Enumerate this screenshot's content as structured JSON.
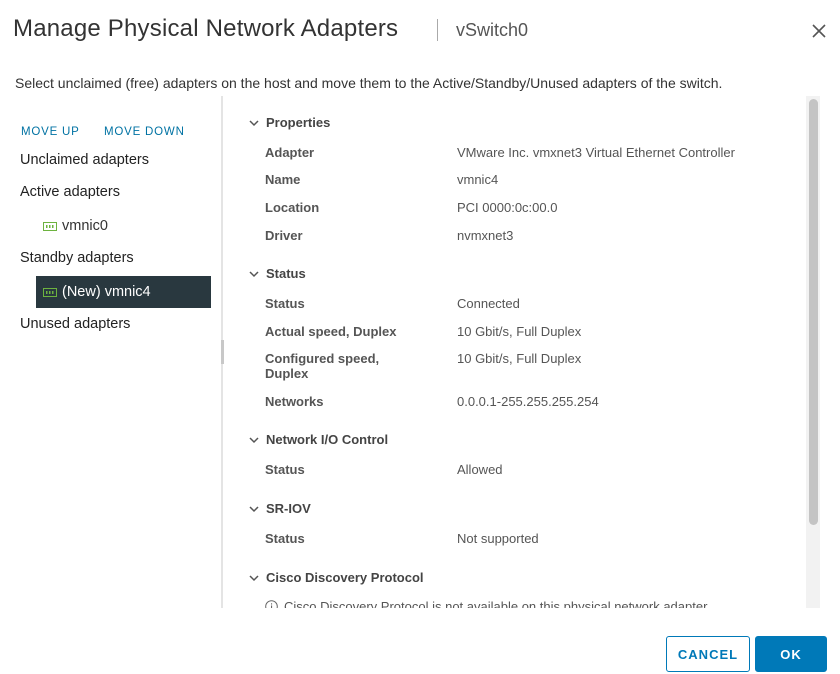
{
  "dialog": {
    "title": "Manage Physical Network Adapters",
    "switch_name": "vSwitch0",
    "instructions": "Select unclaimed (free) adapters on the host and move them to the Active/Standby/Unused adapters of the switch."
  },
  "left": {
    "move_up": "MOVE UP",
    "move_down": "MOVE DOWN",
    "groups": {
      "unclaimed": "Unclaimed adapters",
      "active": "Active adapters",
      "standby": "Standby adapters",
      "unused": "Unused adapters"
    },
    "active_adapters": [
      "vmnic0"
    ],
    "standby_adapters": [
      "(New) vmnic4"
    ],
    "selected_adapter": "(New) vmnic4"
  },
  "details": {
    "properties": {
      "title": "Properties",
      "rows": [
        {
          "key": "Adapter",
          "value": "VMware Inc. vmxnet3 Virtual Ethernet Controller"
        },
        {
          "key": "Name",
          "value": "vmnic4"
        },
        {
          "key": "Location",
          "value": "PCI 0000:0c:00.0"
        },
        {
          "key": "Driver",
          "value": "nvmxnet3"
        }
      ]
    },
    "status": {
      "title": "Status",
      "rows": [
        {
          "key": "Status",
          "value": "Connected"
        },
        {
          "key": "Actual speed, Duplex",
          "value": "10 Gbit/s, Full Duplex"
        },
        {
          "key": "Configured speed, Duplex",
          "value": "10 Gbit/s, Full Duplex"
        },
        {
          "key": "Networks",
          "value": "0.0.0.1-255.255.255.254"
        }
      ]
    },
    "nioc": {
      "title": "Network I/O Control",
      "rows": [
        {
          "key": "Status",
          "value": "Allowed"
        }
      ]
    },
    "sriov": {
      "title": "SR-IOV",
      "rows": [
        {
          "key": "Status",
          "value": "Not supported"
        }
      ]
    },
    "cdp": {
      "title": "Cisco Discovery Protocol",
      "info": "Cisco Discovery Protocol is not available on this physical network adapter"
    }
  },
  "footer": {
    "cancel": "CANCEL",
    "ok": "OK"
  },
  "colors": {
    "accent": "#0079b8",
    "selected_bg": "#29383f",
    "nic_icon": "#6db33f"
  },
  "icons": {
    "close": "close-icon",
    "nic": "network-adapter-icon",
    "chevron": "chevron-down-icon",
    "info": "info-icon"
  }
}
